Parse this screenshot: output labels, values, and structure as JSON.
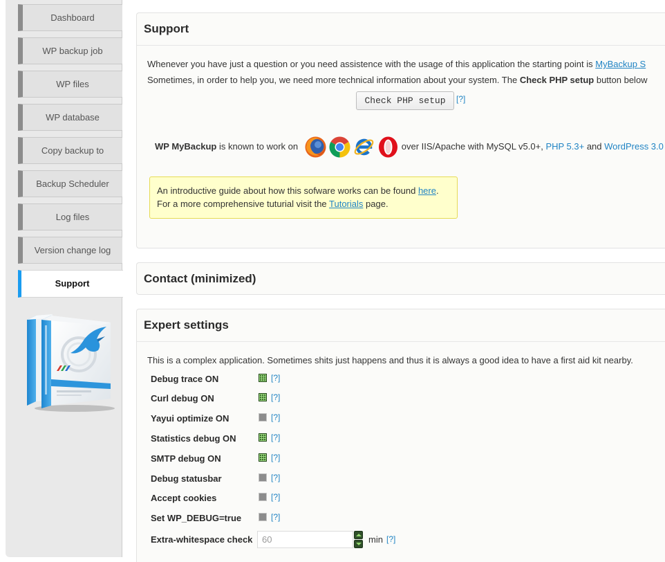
{
  "theme": {
    "active_tab_accent": "#1a9cf0",
    "link_color": "#2184c4",
    "notice_background": "#ffffcc",
    "notice_border": "#e6db55",
    "checked_color": "#39702a",
    "unchecked_color": "#8c8c8c"
  },
  "sidebar": {
    "tabs": [
      {
        "label": "Dashboard",
        "active": false
      },
      {
        "label": "WP backup job",
        "active": false
      },
      {
        "label": "WP files",
        "active": false
      },
      {
        "label": "WP database",
        "active": false
      },
      {
        "label": "Copy backup to",
        "active": false
      },
      {
        "label": "Backup Scheduler",
        "active": false
      },
      {
        "label": "Log files",
        "active": false
      },
      {
        "label": "Version change log",
        "active": false
      },
      {
        "label": "Support",
        "active": true
      }
    ],
    "product_image": "product-box-icon"
  },
  "support": {
    "title": "Support",
    "intro": {
      "text": "Whenever you have just a question or you need assistence with the usage of this application the starting point is ",
      "link": "MyBackup S"
    },
    "php_info": {
      "pre": "Sometimes, in order to help you, we need more technical information about your system. The ",
      "bold": "Check PHP setup",
      "post": " button below"
    },
    "check_php_button": "Check PHP setup",
    "check_php_help": "[?]",
    "compat": {
      "product": "WP MyBackup",
      "works_on": " is known to work on",
      "browser_icons": [
        "firefox-icon",
        "chrome-icon",
        "internet-explorer-icon",
        "opera-icon"
      ],
      "servers": " over IIS/Apache with MySQL v5.0+, ",
      "php_link": "PHP 5.3+",
      "and": " and ",
      "wp_link": "WordPress 3.0"
    },
    "notice": {
      "line1_pre": "An introductive guide about how this sofware works can be found ",
      "line1_link": "here",
      "line1_post": ".",
      "line2_pre": "For a more comprehensive tuturial visit the ",
      "line2_link": "Tutorials",
      "line2_post": " page."
    }
  },
  "contact": {
    "title": "Contact (minimized)"
  },
  "expert": {
    "title": "Expert settings",
    "intro": "This is a complex application. Sometimes shits just happens and thus it is always a good idea to have a first aid kit nearby.",
    "options": [
      {
        "label": "Debug trace ON",
        "checked": true,
        "help": "[?]"
      },
      {
        "label": "Curl debug ON",
        "checked": true,
        "help": "[?]"
      },
      {
        "label": "Yayui optimize ON",
        "checked": false,
        "help": "[?]"
      },
      {
        "label": "Statistics debug ON",
        "checked": true,
        "help": "[?]"
      },
      {
        "label": "SMTP debug ON",
        "checked": true,
        "help": "[?]"
      },
      {
        "label": "Debug statusbar",
        "checked": false,
        "help": "[?]"
      },
      {
        "label": "Accept cookies",
        "checked": false,
        "help": "[?]"
      },
      {
        "label": "Set WP_DEBUG=true",
        "checked": false,
        "help": "[?]"
      }
    ],
    "whitespace": {
      "label": "Extra-whitespace check",
      "value": "60",
      "unit": "min",
      "help": "[?]"
    }
  }
}
